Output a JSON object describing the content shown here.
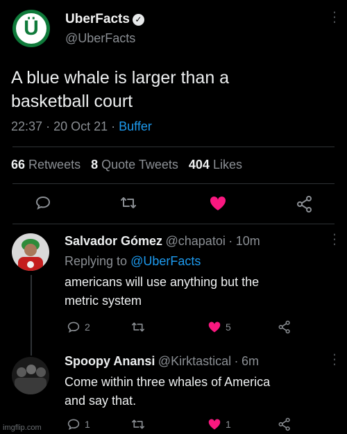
{
  "main_tweet": {
    "author_name": "UberFacts",
    "author_handle": "@UberFacts",
    "avatar_letter": "Ü",
    "text_line1": "A blue whale is larger than a",
    "text_line2": "basketball court",
    "time": "22:37",
    "date": "20 Oct 21",
    "client": "Buffer",
    "sep": "·",
    "retweets_count": "66",
    "retweets_label": "Retweets",
    "quotes_count": "8",
    "quotes_label": "Quote Tweets",
    "likes_count": "404",
    "likes_label": "Likes"
  },
  "replies": [
    {
      "author_name": "Salvador Gómez",
      "author_handle": "@chapatoi",
      "time": "10m",
      "replying_prefix": "Replying to",
      "replying_to": "@UberFacts",
      "text_line1": "americans will use anything but the",
      "text_line2": "metric system",
      "reply_count": "2",
      "like_count": "5"
    },
    {
      "author_name": "Spoopy Anansi",
      "author_handle": "@Kirktastical",
      "time": "6m",
      "text_line1": "Come within three whales of America",
      "text_line2": "and say that.",
      "reply_count": "1",
      "like_count": "1"
    }
  ],
  "watermark": "imgflip.com",
  "colors": {
    "like": "#f91880",
    "link": "#1d9bf0",
    "muted": "#8b8f94"
  }
}
